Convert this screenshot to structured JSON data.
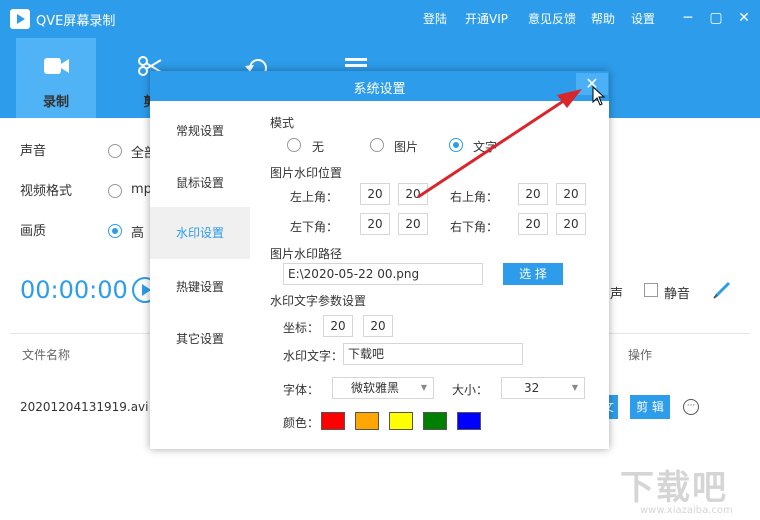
{
  "app": {
    "title": "QVE屏幕录制",
    "menu": [
      "登陆",
      "开通VIP",
      "意见反馈",
      "帮助",
      "设置"
    ],
    "window_controls": {
      "minimize": "─",
      "maximize": "▢",
      "close": "✕"
    }
  },
  "toolbar": {
    "tabs": [
      {
        "label": "录制",
        "icon": "camera-icon"
      },
      {
        "label": "剪",
        "icon": "scissors-icon"
      },
      {
        "label": "",
        "icon": "rotate-icon"
      },
      {
        "label": "",
        "icon": "list-icon"
      }
    ]
  },
  "settings": {
    "sound_label": "声音",
    "sound_value": "全部",
    "format_label": "视频格式",
    "format_value": "mp",
    "quality_label": "画质",
    "quality_value": "高"
  },
  "recorder": {
    "timer": "00:00:00",
    "sound_suffix": "声",
    "mute_label": "静音"
  },
  "file_list": {
    "col_name": "文件名称",
    "col_action": "操作",
    "rows": [
      {
        "name": "20201204131919.avi",
        "btn_open": "文",
        "btn_edit": "剪 辑"
      }
    ]
  },
  "dialog": {
    "title": "系统设置",
    "close": "✕",
    "sidebar": [
      "常规设置",
      "鼠标设置",
      "水印设置",
      "热键设置",
      "其它设置"
    ],
    "active_tab": "水印设置",
    "mode": {
      "label": "模式",
      "options": [
        "无",
        "图片",
        "文字"
      ],
      "selected": "文字"
    },
    "image_position": {
      "label": "图片水印位置",
      "top_left_label": "左上角：",
      "top_left": [
        "20",
        "20"
      ],
      "top_right_label": "右上角：",
      "top_right": [
        "20",
        "20"
      ],
      "bottom_left_label": "左下角：",
      "bottom_left": [
        "20",
        "20"
      ],
      "bottom_right_label": "右下角：",
      "bottom_right": [
        "20",
        "20"
      ]
    },
    "image_path": {
      "label": "图片水印路径",
      "value": "E:\\2020-05-22 00.png",
      "select_button": "选 择"
    },
    "text_params": {
      "label": "水印文字参数设置",
      "coords_label": "坐标：",
      "coords": [
        "20",
        "20"
      ],
      "text_label": "水印文字：",
      "text_value": "下载吧",
      "font_label": "字体：",
      "font_value": "微软雅黑",
      "size_label": "大小：",
      "size_value": "32",
      "color_label": "颜色：",
      "colors": [
        "#ff0000",
        "#ffa500",
        "#ffff00",
        "#008000",
        "#0000ff"
      ]
    }
  },
  "watermark": {
    "text": "下载吧",
    "url": "www.xiazaiba.com"
  },
  "colors": {
    "accent": "#2d9cea",
    "annotation_arrow": "#d9262c"
  }
}
